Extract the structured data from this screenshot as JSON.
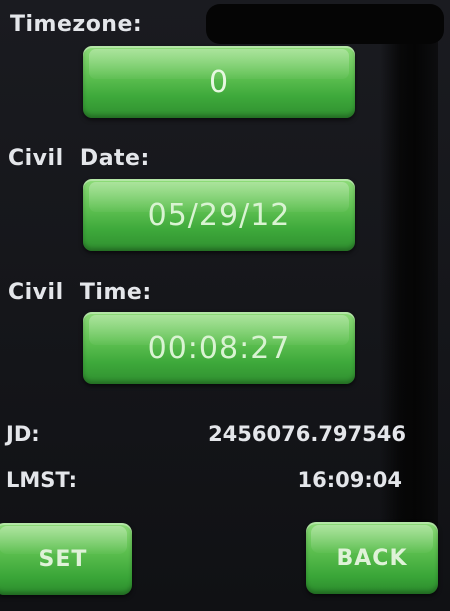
{
  "timezone": {
    "label": "Timezone:",
    "value": "0"
  },
  "civil_date": {
    "label": "Civil  Date:",
    "value": "05/29/12"
  },
  "civil_time": {
    "label": "Civil  Time:",
    "value": "00:08:27"
  },
  "jd": {
    "label": "JD:",
    "value": "2456076.797546"
  },
  "lmst": {
    "label": "LMST:",
    "value": "16:09:04"
  },
  "buttons": {
    "set": "SET",
    "back": "BACK"
  },
  "colors": {
    "button_green": "#4fb845",
    "background": "#17181c",
    "text": "#e4e6ea"
  }
}
